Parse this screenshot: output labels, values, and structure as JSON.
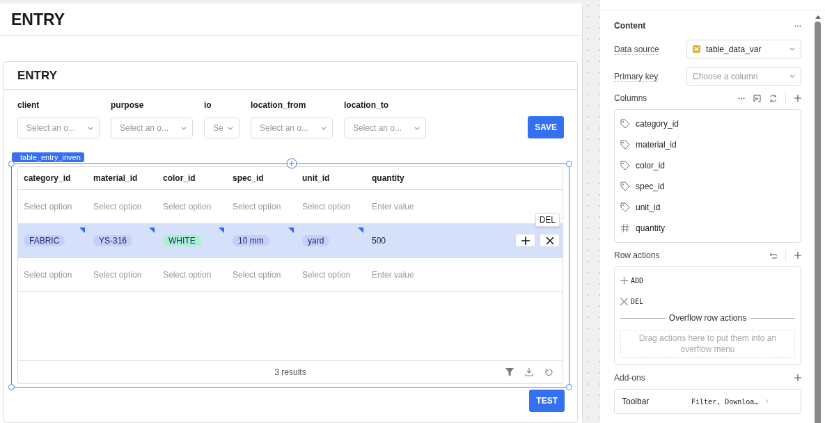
{
  "page_title": "ENTRY",
  "card": {
    "title": "ENTRY",
    "filters": [
      {
        "label": "client",
        "placeholder": "Select an o..."
      },
      {
        "label": "purpose",
        "placeholder": "Select an o..."
      },
      {
        "label": "io",
        "placeholder": "Se"
      },
      {
        "label": "location_from",
        "placeholder": "Select an o..."
      },
      {
        "label": "location_to",
        "placeholder": "Select an o..."
      }
    ],
    "save_button": "SAVE",
    "test_button": "TEST"
  },
  "table": {
    "tag": "table_entry_inven",
    "columns": [
      "category_id",
      "material_id",
      "color_id",
      "spec_id",
      "unit_id",
      "quantity"
    ],
    "rows": [
      {
        "selected": false,
        "cells": [
          {
            "kind": "placeholder",
            "text": "Select option"
          },
          {
            "kind": "placeholder",
            "text": "Select option"
          },
          {
            "kind": "placeholder",
            "text": "Select option"
          },
          {
            "kind": "placeholder",
            "text": "Select option"
          },
          {
            "kind": "placeholder",
            "text": "Select option"
          },
          {
            "kind": "placeholder",
            "text": "Enter value"
          }
        ]
      },
      {
        "selected": true,
        "cells": [
          {
            "kind": "tag",
            "text": "FABRIC",
            "color": "#c3d0f7",
            "changed": true
          },
          {
            "kind": "tag",
            "text": "YS-316",
            "color": "#c3d0f7",
            "changed": true
          },
          {
            "kind": "tag",
            "text": "WHITE",
            "color": "#a7f0d0",
            "changed": true
          },
          {
            "kind": "tag",
            "text": "10 mm",
            "color": "#c3d0f7",
            "changed": true
          },
          {
            "kind": "tag",
            "text": "yard",
            "color": "#c3d0f7",
            "changed": true
          },
          {
            "kind": "value",
            "text": "500",
            "changed": false
          }
        ]
      },
      {
        "selected": false,
        "cells": [
          {
            "kind": "placeholder",
            "text": "Select option"
          },
          {
            "kind": "placeholder",
            "text": "Select option"
          },
          {
            "kind": "placeholder",
            "text": "Select option"
          },
          {
            "kind": "placeholder",
            "text": "Select option"
          },
          {
            "kind": "placeholder",
            "text": "Select option"
          },
          {
            "kind": "placeholder",
            "text": "Enter value"
          }
        ]
      }
    ],
    "action_tooltip": "DEL",
    "footer": "3 results"
  },
  "panel": {
    "section": "Content",
    "data_source": {
      "label": "Data source",
      "value": "table_data_var"
    },
    "primary_key": {
      "label": "Primary key",
      "placeholder": "Choose a column"
    },
    "columns_title": "Columns",
    "columns": [
      {
        "kind": "tag",
        "name": "category_id"
      },
      {
        "kind": "tag",
        "name": "material_id"
      },
      {
        "kind": "tag",
        "name": "color_id"
      },
      {
        "kind": "tag",
        "name": "spec_id"
      },
      {
        "kind": "tag",
        "name": "unit_id"
      },
      {
        "kind": "number",
        "name": "quantity"
      }
    ],
    "row_actions_title": "Row actions",
    "row_actions": [
      {
        "kind": "add",
        "label": "ADD"
      },
      {
        "kind": "delete",
        "label": "DEL"
      }
    ],
    "overflow_title": "Overflow row actions",
    "overflow_hint": "Drag actions here to put them into an overflow menu",
    "addons_title": "Add-ons",
    "addons": [
      {
        "name": "Toolbar",
        "value": "Filter, Downloa…"
      }
    ]
  }
}
